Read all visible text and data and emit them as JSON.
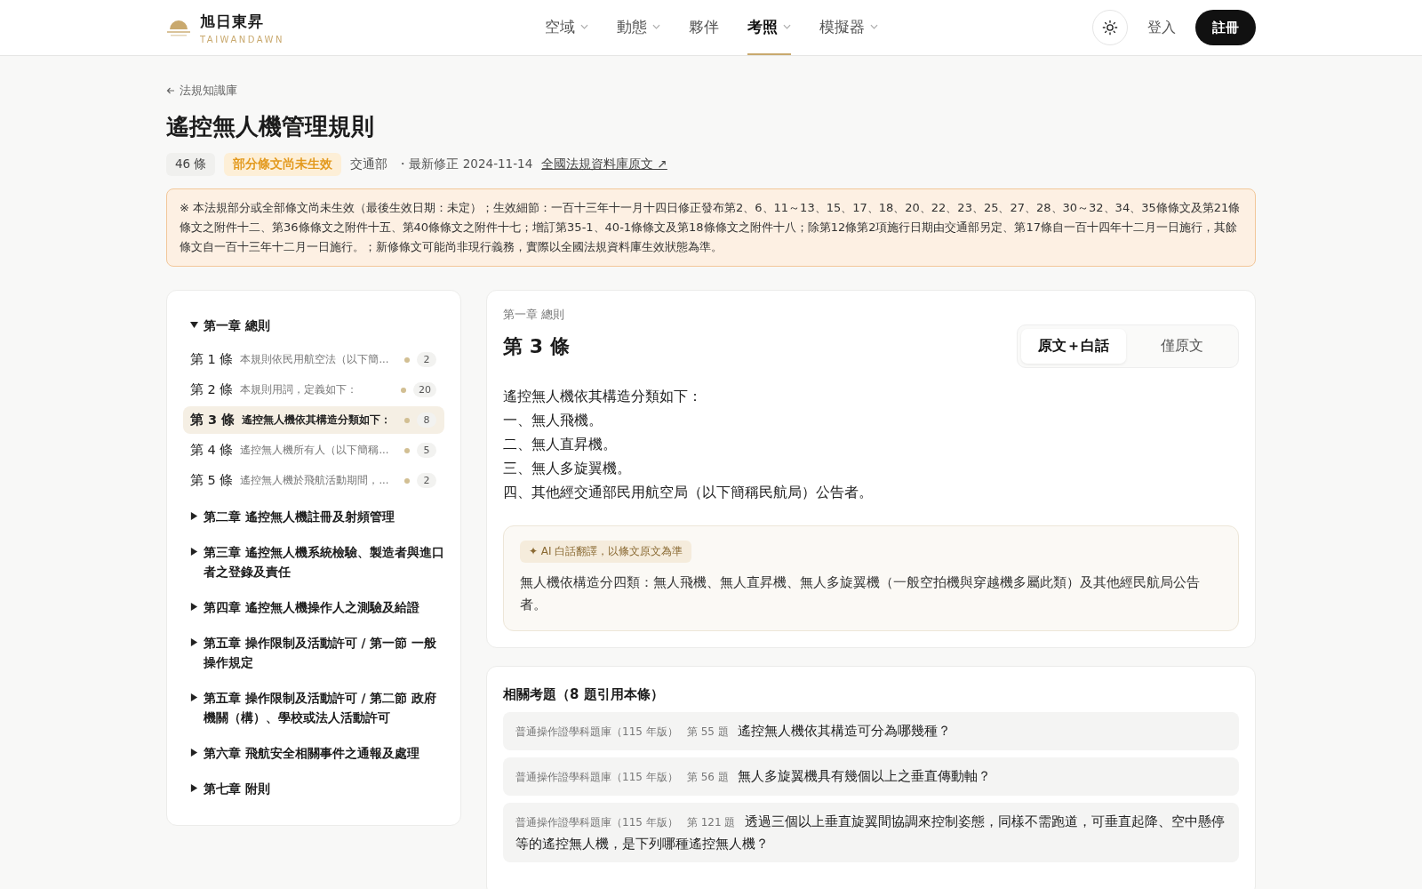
{
  "header": {
    "brand": {
      "name": "旭日東昇",
      "sub": "TAIWANDAWN"
    },
    "nav": [
      {
        "label": "空域",
        "dropdown": true,
        "selected": false
      },
      {
        "label": "動態",
        "dropdown": true,
        "selected": false
      },
      {
        "label": "夥伴",
        "dropdown": false,
        "selected": false
      },
      {
        "label": "考照",
        "dropdown": true,
        "selected": true
      },
      {
        "label": "模擬器",
        "dropdown": true,
        "selected": false
      }
    ],
    "login": "登入",
    "register": "註冊"
  },
  "breadcrumb": "法規知識庫",
  "title": "遙控無人機管理規則",
  "meta": {
    "count": "46 條",
    "status": "部分條文尚未生效",
    "agency": "交通部",
    "revised": "・最新修正 2024-11-14",
    "link": "全國法規資料庫原文 ↗"
  },
  "notice": "※ 本法規部分或全部條文尚未生效（最後生效日期：未定）；生效細節：一百十三年十一月十四日修正發布第2、6、11～13、15、17、18、20、22、23、25、27、28、30～32、34、35條條文及第21條條文之附件十二、第36條條文之附件十五、第40條條文之附件十七；增訂第35-1、40-1條條文及第18條條文之附件十八；除第12條第2項施行日期由交通部另定、第17條自一百十四年十二月一日施行，其餘條文自一百十三年十二月一日施行。；新修條文可能尚非現行義務，實際以全國法規資料庫生效狀態為準。",
  "sidebar": {
    "chapters": [
      {
        "title": "第一章 總則",
        "expanded": true,
        "articles": [
          {
            "no": "第 1 條",
            "summary": "本規則依民用航空法（以下簡...",
            "count": "2",
            "selected": false
          },
          {
            "no": "第 2 條",
            "summary": "本規則用詞，定義如下：",
            "count": "20",
            "selected": false
          },
          {
            "no": "第 3 條",
            "summary": "遙控無人機依其構造分類如下：",
            "count": "8",
            "selected": true
          },
          {
            "no": "第 4 條",
            "summary": "遙控無人機所有人（以下簡稱...",
            "count": "5",
            "selected": false
          },
          {
            "no": "第 5 條",
            "summary": "遙控無人機於飛航活動期間，...",
            "count": "2",
            "selected": false
          }
        ]
      },
      {
        "title": "第二章 遙控無人機註冊及射頻管理",
        "expanded": false
      },
      {
        "title": "第三章 遙控無人機系統檢驗、製造者與進口者之登錄及責任",
        "expanded": false
      },
      {
        "title": "第四章 遙控無人機操作人之測驗及給證",
        "expanded": false
      },
      {
        "title": "第五章 操作限制及活動許可 / 第一節 一般操作規定",
        "expanded": false
      },
      {
        "title": "第五章 操作限制及活動許可 / 第二節 政府機關（構）、學校或法人活動許可",
        "expanded": false
      },
      {
        "title": "第六章 飛航安全相關事件之通報及處理",
        "expanded": false
      },
      {
        "title": "第七章 附則",
        "expanded": false
      }
    ]
  },
  "article": {
    "chapter": "第一章 總則",
    "title": "第 3 條",
    "modes": [
      {
        "label": "原文＋白話",
        "selected": true
      },
      {
        "label": "僅原文",
        "selected": false
      }
    ],
    "lines": [
      "遙控無人機依其構造分類如下：",
      "一、無人飛機。",
      "二、無人直昇機。",
      "三、無人多旋翼機。",
      "四、其他經交通部民用航空局（以下簡稱民航局）公告者。"
    ],
    "ai": {
      "badge": "✦ AI 白話翻譯，以條文原文為準",
      "text": "無人機依構造分四類：無人飛機、無人直昇機、無人多旋翼機（一般空拍機與穿越機多屬此類）及其他經民航局公告者。"
    }
  },
  "questions": {
    "title": "相關考題（8 題引用本條）",
    "items": [
      {
        "bank": "普通操作證學科題庫（115 年版）",
        "no": "第 55 題",
        "text": "遙控無人機依其構造可分為哪幾種？"
      },
      {
        "bank": "普通操作證學科題庫（115 年版）",
        "no": "第 56 題",
        "text": "無人多旋翼機具有幾個以上之垂直傳動軸？"
      },
      {
        "bank": "普通操作證學科題庫（115 年版）",
        "no": "第 121 題",
        "text": "透過三個以上垂直旋翼間協調來控制姿態，同樣不需跑道，可垂直起降、空中懸停等的遙控無人機，是下列哪種遙控無人機？"
      }
    ]
  }
}
